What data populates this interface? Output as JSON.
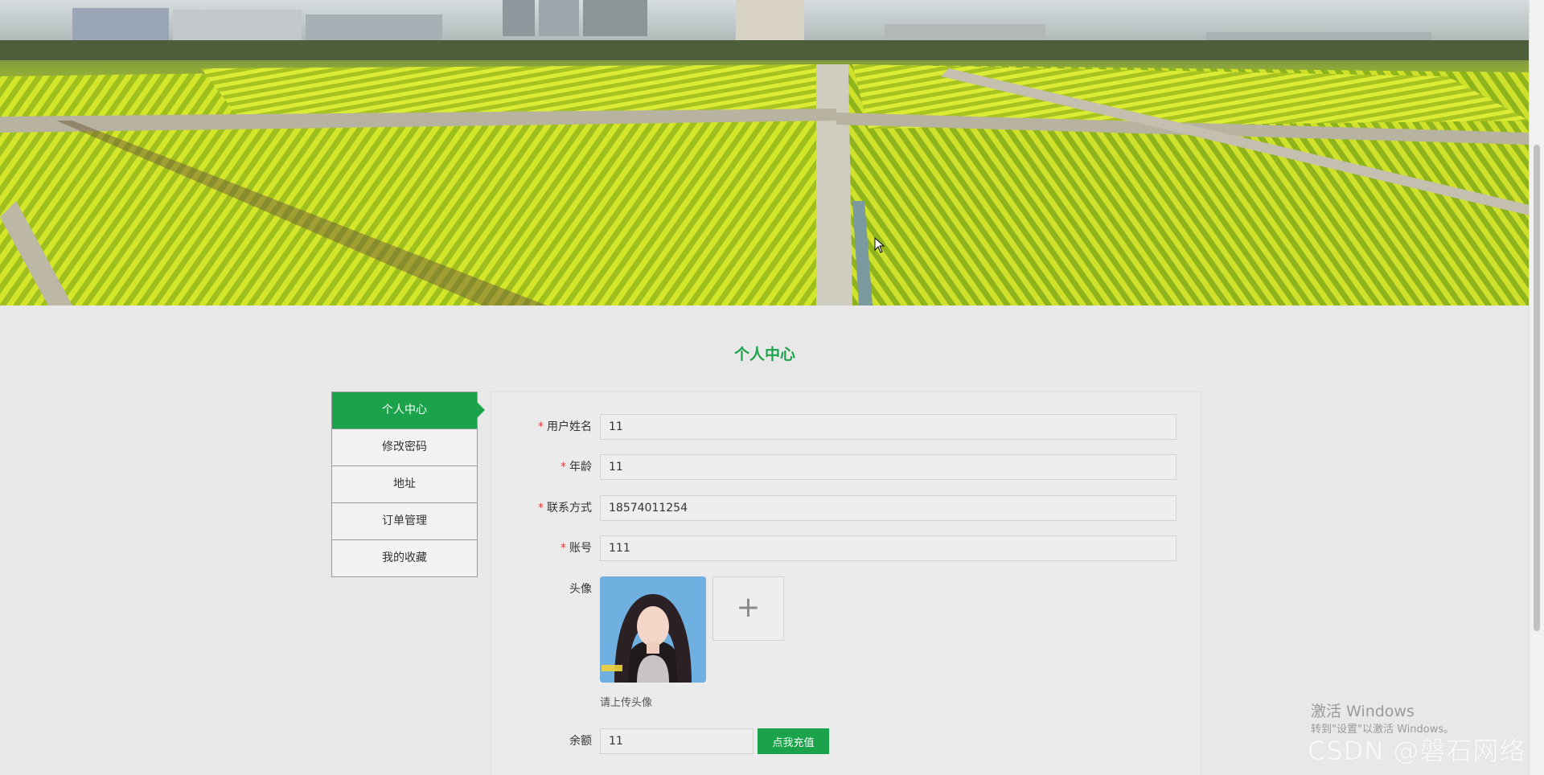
{
  "header": {
    "title": "个人中心"
  },
  "sidebar": {
    "items": [
      {
        "label": "个人中心",
        "active": true
      },
      {
        "label": "修改密码",
        "active": false
      },
      {
        "label": "地址",
        "active": false
      },
      {
        "label": "订单管理",
        "active": false
      },
      {
        "label": "我的收藏",
        "active": false
      }
    ]
  },
  "form": {
    "username": {
      "label": "用户姓名",
      "value": "11",
      "required": true
    },
    "age": {
      "label": "年龄",
      "value": "11",
      "required": true
    },
    "contact": {
      "label": "联系方式",
      "value": "18574011254",
      "required": true
    },
    "account": {
      "label": "账号",
      "value": "111",
      "required": true
    },
    "avatar": {
      "label": "头像",
      "upload_hint": "请上传头像",
      "upload_icon": "plus-icon"
    },
    "balance": {
      "label": "余额",
      "value": "11",
      "recharge_label": "点我充值"
    }
  },
  "watermark": {
    "windows_title": "激活 Windows",
    "windows_sub": "转到\"设置\"以激活 Windows。",
    "csdn": "CSDN @磐石网络"
  },
  "colors": {
    "accent": "#1aa34a",
    "required": "#e03b3b",
    "background": "#e8e8e8"
  }
}
